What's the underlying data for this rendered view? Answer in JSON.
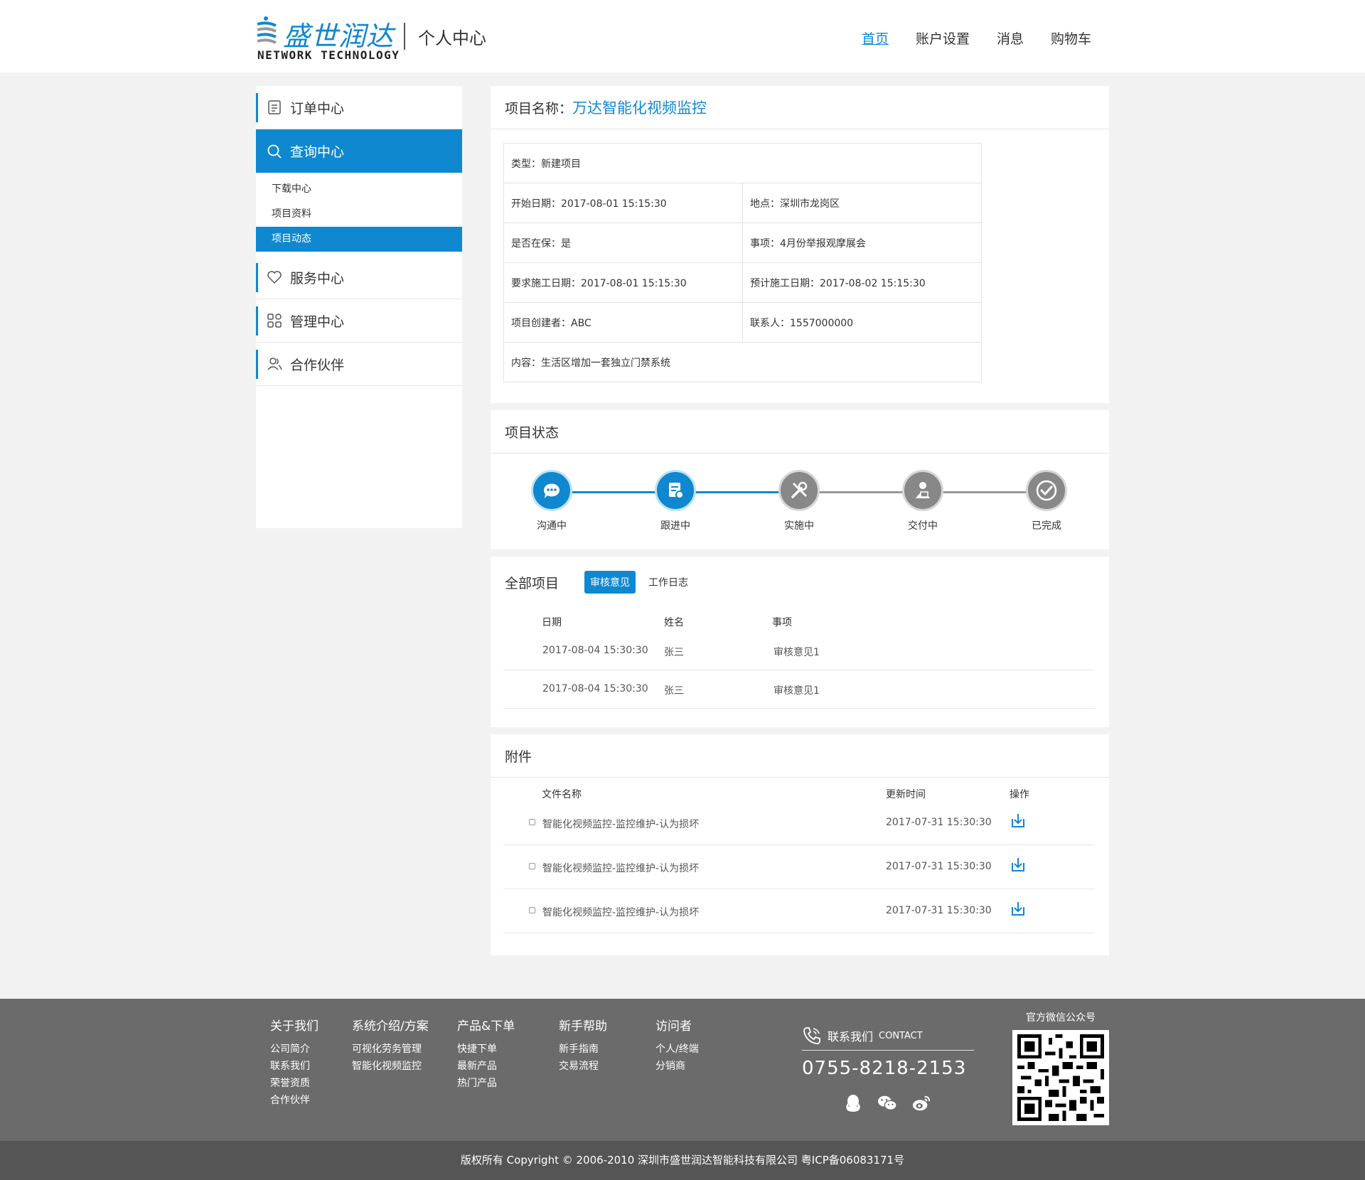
{
  "header": {
    "logo_cn": "盛世润达",
    "logo_en": "NETWORK TECHNOLOGY",
    "title": "个人中心",
    "nav": [
      {
        "label": "首页",
        "active": true
      },
      {
        "label": "账户设置"
      },
      {
        "label": "消息"
      },
      {
        "label": "购物车"
      }
    ]
  },
  "sidebar": {
    "order_center": "订单中心",
    "query_center": "查询中心",
    "sub_items": [
      "下载中心",
      "项目资料",
      "项目动态"
    ],
    "service_center": "服务中心",
    "manage_center": "管理中心",
    "partners": "合作伙伴"
  },
  "project": {
    "label": "项目名称：",
    "name": "万达智能化视频监控",
    "type": "类型：新建项目",
    "start_date": "开始日期：2017-08-01 15:15:30",
    "location": "地点：深圳市龙岗区",
    "warranty": "是否在保：是",
    "matter": "事项：4月份举报观摩展会",
    "required_date": "要求施工日期：2017-08-01 15:15:30",
    "expected_date": "预计施工日期：2017-08-02 15:15:30",
    "creator": "项目创建者：ABC",
    "contact": "联系人：1557000000",
    "content": "内容：生活区增加一套独立门禁系统"
  },
  "status": {
    "title": "项目状态",
    "steps": [
      {
        "label": "沟通中",
        "done": true
      },
      {
        "label": "跟进中",
        "done": true
      },
      {
        "label": "实施中",
        "done": false
      },
      {
        "label": "交付中",
        "done": false
      },
      {
        "label": "已完成",
        "done": false
      }
    ]
  },
  "all_projects": {
    "title": "全部项目",
    "tabs": [
      "审核意见",
      "工作日志"
    ],
    "headers": [
      "日期",
      "姓名",
      "事项"
    ],
    "rows": [
      [
        "2017-08-04 15:30:30",
        "张三",
        "审核意见1"
      ],
      [
        "2017-08-04 15:30:30",
        "张三",
        "审核意见1"
      ]
    ]
  },
  "attachments": {
    "title": "附件",
    "headers": [
      "文件名称",
      "更新时间",
      "操作"
    ],
    "rows": [
      [
        "智能化视频监控-监控维护-认为损坏",
        "2017-07-31 15:30:30"
      ],
      [
        "智能化视频监控-监控维护-认为损坏",
        "2017-07-31 15:30:30"
      ],
      [
        "智能化视频监控-监控维护-认为损坏",
        "2017-07-31 15:30:30"
      ]
    ]
  },
  "footer": {
    "columns": [
      {
        "title": "关于我们",
        "links": [
          "公司简介",
          "联系我们",
          "荣誉资质",
          "合作伙伴"
        ]
      },
      {
        "title": "系统介绍/方案",
        "links": [
          "可视化劳务管理",
          "智能化视频监控"
        ]
      },
      {
        "title": "产品&下单",
        "links": [
          "快捷下单",
          "最新产品",
          "热门产品"
        ]
      },
      {
        "title": "新手帮助",
        "links": [
          "新手指南",
          "交易流程"
        ]
      },
      {
        "title": "访问者",
        "links": [
          "个人/终端",
          "分销商"
        ]
      }
    ],
    "contact_label": "联系我们",
    "contact_en": "CONTACT",
    "phone": "0755-8218-2153",
    "qr_label": "官方微信公众号",
    "copyright": "版权所有  Copyright © 2006-2010  深圳市盛世润达智能科技有限公司  粤ICP备06083171号"
  },
  "colors": {
    "accent": "#1088cf",
    "footer": "#6b6b6b",
    "copyright_bar": "#555555"
  }
}
